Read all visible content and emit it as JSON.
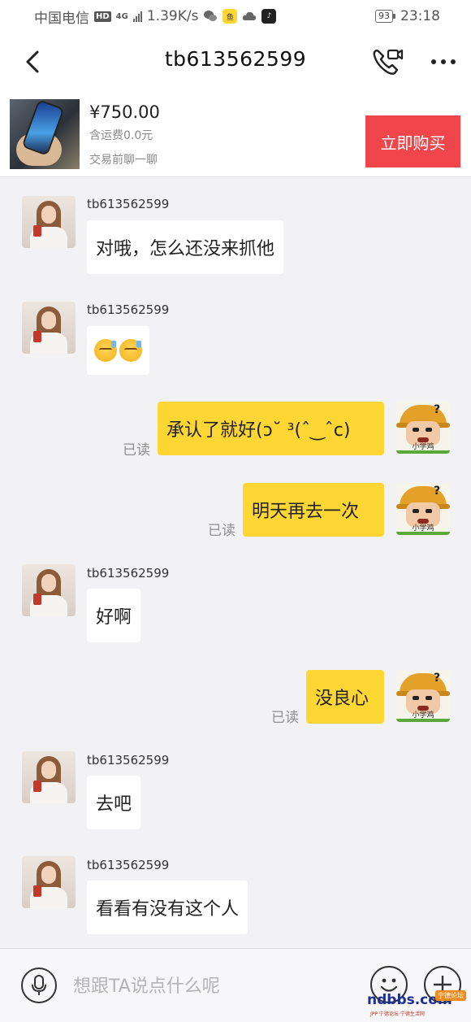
{
  "status_bar": {
    "carrier": "中国电信",
    "hd": "HD",
    "network": "4G",
    "speed": "1.39K/s",
    "battery": "93",
    "time": "23:18"
  },
  "header": {
    "title": "tb613562599"
  },
  "product": {
    "price": "¥750.00",
    "shipping": "含运费0.0元",
    "tip": "交易前聊一聊",
    "buy_label": "立即购买"
  },
  "messages": [
    {
      "side": "left",
      "sender": "tb613562599",
      "text": "对哦，怎么还没来抓他"
    },
    {
      "side": "left",
      "sender": "tb613562599",
      "emoji": "sweat-smile-emoji"
    },
    {
      "side": "right",
      "status": "已读",
      "text": "承认了就好(ↄ˘ ³(ˆ‿ˆc)"
    },
    {
      "side": "right",
      "status": "已读",
      "text": "明天再去一次"
    },
    {
      "side": "left",
      "sender": "tb613562599",
      "text": "好啊"
    },
    {
      "side": "right",
      "status": "已读",
      "text": "没良心"
    },
    {
      "side": "left",
      "sender": "tb613562599",
      "text": "去吧"
    },
    {
      "side": "left",
      "sender": "tb613562599",
      "text": "看看有没有这个人"
    }
  ],
  "my_avatar_caption": "小学鸡",
  "input": {
    "placeholder": "想跟TA说点什么呢"
  },
  "watermark": {
    "main": "ndbbs.com",
    "tag": "宁德论坛",
    "sub": "JPP·宁德论坛·宁德生活网"
  },
  "colors": {
    "buy_button": "#f0464b",
    "my_bubble": "#ffd633",
    "their_bubble": "#ffffff",
    "background": "#f2f2f4"
  }
}
